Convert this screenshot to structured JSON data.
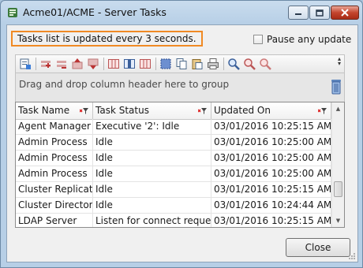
{
  "window": {
    "title": "Acme01/ACME - Server Tasks",
    "app_icon": "server-tasks-icon",
    "controls": [
      "minimize-icon",
      "maximize-icon",
      "close-icon"
    ]
  },
  "status": {
    "message": "Tasks list is updated every 3 seconds.",
    "highlight_color": "#f08a24"
  },
  "pause": {
    "label": "Pause any update",
    "checked": false
  },
  "toolbar": {
    "icons": [
      "export-icon",
      "add-icon",
      "remove-icon",
      "move-up-icon",
      "move-down-icon",
      "columns-icon",
      "split-view-icon",
      "columns-right-icon",
      "select-all-icon",
      "copy-icon",
      "paste-icon",
      "print-icon",
      "find-icon",
      "find-next-icon",
      "clear-find-icon"
    ]
  },
  "group_panel": {
    "label": "Drag and drop column header here to group",
    "trash_icon": "delete-icon"
  },
  "grid": {
    "columns": [
      "Task Name",
      "Task Status",
      "Updated On"
    ],
    "rows": [
      {
        "name": "Agent Manager",
        "status": "Executive '2': Idle",
        "updated": "03/01/2016 10:25:15 AM"
      },
      {
        "name": "Admin Process",
        "status": "Idle",
        "updated": "03/01/2016 10:25:00 AM"
      },
      {
        "name": "Admin Process",
        "status": "Idle",
        "updated": "03/01/2016 10:25:00 AM"
      },
      {
        "name": "Admin Process",
        "status": "Idle",
        "updated": "03/01/2016 10:25:00 AM"
      },
      {
        "name": "Cluster Replicator",
        "status": "Idle",
        "updated": "03/01/2016 10:25:15 AM"
      },
      {
        "name": "Cluster Directory",
        "status": "Idle",
        "updated": "03/01/2016 10:24:44 AM"
      },
      {
        "name": "LDAP Server",
        "status": "Listen for connect reques...",
        "updated": "03/01/2016 10:25:15 AM"
      }
    ]
  },
  "footer": {
    "close_label": "Close"
  }
}
